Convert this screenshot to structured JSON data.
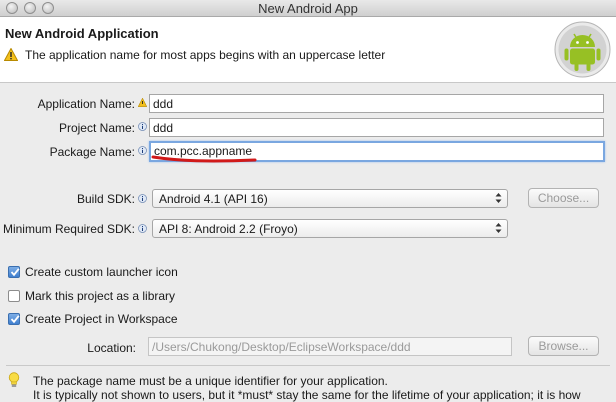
{
  "window": {
    "title": "New Android App"
  },
  "header": {
    "title": "New Android Application",
    "message": "The application name for most apps begins with an uppercase letter"
  },
  "form": {
    "application_name": {
      "label": "Application Name:",
      "value": "ddd"
    },
    "project_name": {
      "label": "Project Name:",
      "value": "ddd"
    },
    "package_name": {
      "label": "Package Name:",
      "value": "com.pcc.appname"
    },
    "build_sdk": {
      "label": "Build SDK:",
      "value": "Android 4.1 (API 16)",
      "button": "Choose..."
    },
    "min_sdk": {
      "label": "Minimum Required SDK:",
      "value": "API 8: Android 2.2 (Froyo)"
    }
  },
  "options": {
    "launcher_icon": {
      "label": "Create custom launcher icon",
      "checked": true
    },
    "library": {
      "label": "Mark this project as a library",
      "checked": false
    },
    "workspace": {
      "label": "Create Project in Workspace",
      "checked": true
    }
  },
  "location": {
    "label": "Location:",
    "value": "/Users/Chukong/Desktop/EclipseWorkspace/ddd",
    "button": "Browse..."
  },
  "footer": {
    "line1": "The package name must be a unique identifier for your application.",
    "line2": "It is typically not shown to users, but it *must* stay the same for the lifetime of your application; it is how"
  },
  "colors": {
    "annotation": "#d11a1a",
    "focus": "#7aa7e0",
    "android": "#97c024"
  }
}
